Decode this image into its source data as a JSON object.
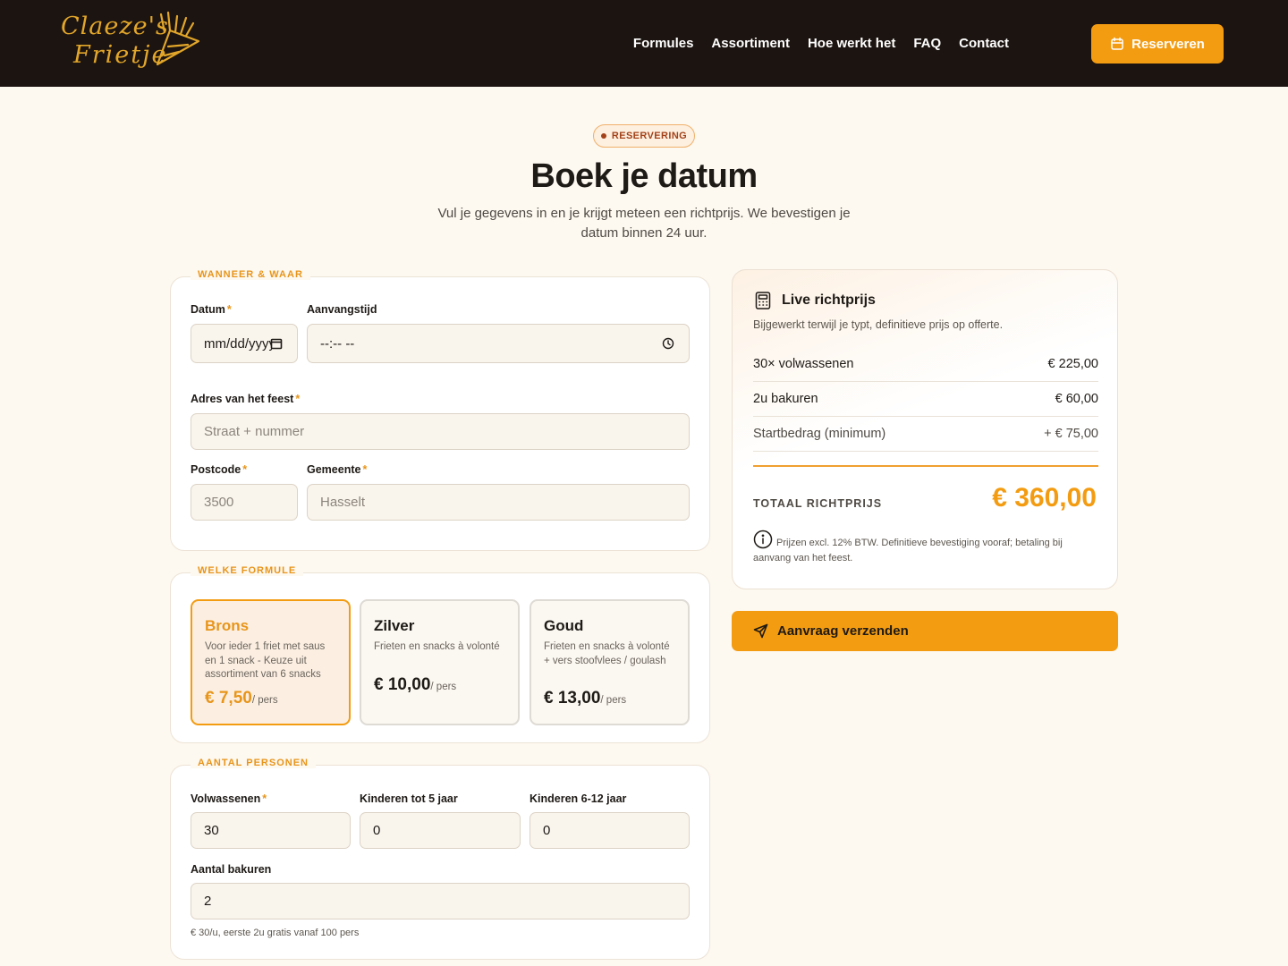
{
  "brand": {
    "line1": "Claeze's",
    "line2": "Frietje"
  },
  "nav": {
    "items": [
      "Formules",
      "Assortiment",
      "Hoe werkt het",
      "FAQ",
      "Contact"
    ],
    "cta_label": "Reserveren"
  },
  "hero": {
    "badge": "RESERVERING",
    "title": "Boek je datum",
    "subtitle": "Vul je gegevens in en je krijgt meteen een richtprijs. We bevestigen je datum binnen 24 uur."
  },
  "when_where": {
    "legend": "WANNEER & WAAR",
    "date": {
      "label": "Datum",
      "value": "mm/dd/yyyy"
    },
    "time": {
      "label": "Aanvangstijd",
      "value": "--:-- --"
    },
    "address": {
      "label": "Adres van het feest",
      "placeholder": "Straat + nummer"
    },
    "postcode": {
      "label": "Postcode",
      "placeholder": "3500"
    },
    "city": {
      "label": "Gemeente",
      "placeholder": "Hasselt"
    }
  },
  "formula": {
    "legend": "WELKE FORMULE",
    "per_label": "/ pers",
    "options": [
      {
        "name": "Brons",
        "desc": "Voor ieder 1 friet met saus en 1 snack - Keuze uit assortiment van 6 snacks",
        "price": "€ 7,50",
        "selected": true
      },
      {
        "name": "Zilver",
        "desc": "Frieten en snacks à volonté",
        "price": "€ 10,00",
        "selected": false
      },
      {
        "name": "Goud",
        "desc": "Frieten en snacks à volonté + vers stoofvlees / goulash",
        "price": "€ 13,00",
        "selected": false
      }
    ]
  },
  "persons": {
    "legend": "AANTAL PERSONEN",
    "adults": {
      "label": "Volwassenen",
      "value": "30"
    },
    "kids_under5": {
      "label": "Kinderen tot 5 jaar",
      "value": "0"
    },
    "kids_6_12": {
      "label": "Kinderen 6-12 jaar",
      "value": "0"
    },
    "hours": {
      "label": "Aantal bakuren",
      "value": "2"
    },
    "hours_hint": "€ 30/u, eerste 2u gratis vanaf 100 pers"
  },
  "summary": {
    "title": "Live richtprijs",
    "subtitle": "Bijgewerkt terwijl je typt, definitieve prijs op offerte.",
    "rows": [
      {
        "label": "30× volwassenen",
        "value": "€ 225,00"
      },
      {
        "label": "2u bakuren",
        "value": "€ 60,00"
      },
      {
        "label": "Startbedrag (minimum)",
        "value": "+ € 75,00"
      }
    ],
    "total_label": "TOTAAL RICHTPRIJS",
    "total_value": "€ 360,00",
    "note": "Prijzen excl. 12% BTW. Definitieve bevestiging vooraf; betaling bij aanvang van het feest."
  },
  "submit_label": "Aanvraag verzenden",
  "colors": {
    "accent": "#f39c12",
    "header_bg": "#1c1410",
    "page_bg": "#fdf8f0"
  }
}
